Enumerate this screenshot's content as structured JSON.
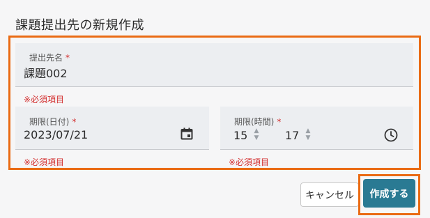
{
  "dialog": {
    "title": "課題提出先の新規作成"
  },
  "form": {
    "name": {
      "label": "提出先名",
      "required_mark": "*",
      "value": "課題002",
      "error": "※必須項目"
    },
    "deadline_date": {
      "label": "期限(日付)",
      "required_mark": "*",
      "value": "2023/07/21",
      "error": "※必須項目",
      "icon": "calendar-icon"
    },
    "deadline_time": {
      "label": "期限(時間)",
      "required_mark": "*",
      "hour": "15",
      "minute": "17",
      "error": "※必須項目",
      "icon": "clock-icon",
      "spinner_up": "▲",
      "spinner_down": "▼"
    }
  },
  "actions": {
    "cancel_label": "キャンセル",
    "create_label": "作成する"
  },
  "colors": {
    "highlight": "#ea6b14",
    "primary": "#2a7a93",
    "error": "#d32f2f"
  }
}
